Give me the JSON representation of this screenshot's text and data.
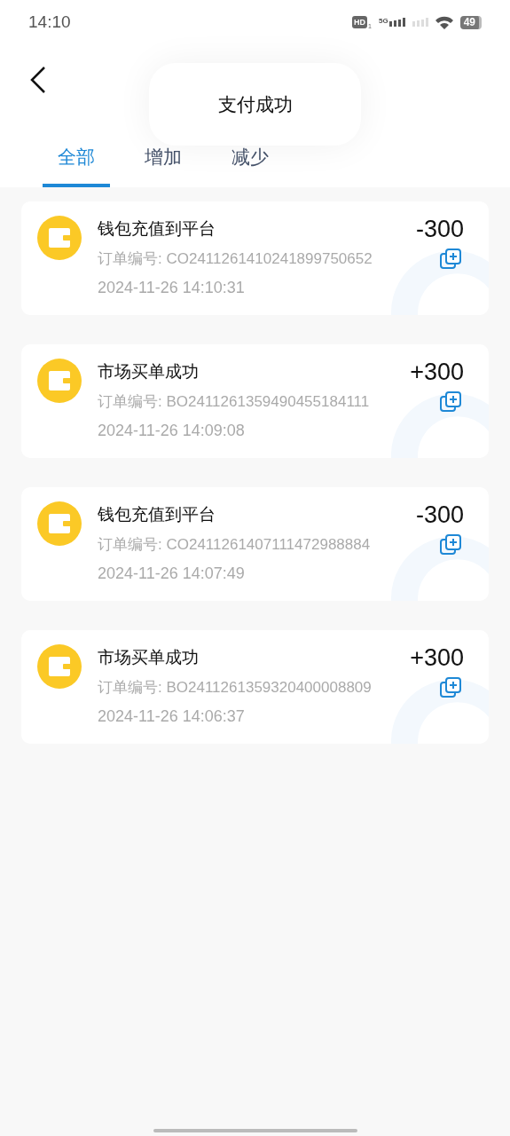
{
  "status_bar": {
    "time": "14:10",
    "hd_badge": "HD",
    "sim_index": "1",
    "network": "5G",
    "battery": "49"
  },
  "toast": {
    "message": "支付成功"
  },
  "tabs": [
    {
      "label": "全部",
      "selected": true
    },
    {
      "label": "增加",
      "selected": false
    },
    {
      "label": "减少",
      "selected": false
    }
  ],
  "transactions": [
    {
      "title": "钱包充值到平台",
      "amount": "-300",
      "order_no": "订单编号: CO2411261410241899750652",
      "time": "2024-11-26 14:10:31"
    },
    {
      "title": "市场买单成功",
      "amount": "+300",
      "order_no": "订单编号: BO2411261359490455184111",
      "time": "2024-11-26 14:09:08"
    },
    {
      "title": "钱包充值到平台",
      "amount": "-300",
      "order_no": "订单编号: CO2411261407111472988884",
      "time": "2024-11-26 14:07:49"
    },
    {
      "title": "市场买单成功",
      "amount": "+300",
      "order_no": "订单编号: BO2411261359320400008809",
      "time": "2024-11-26 14:06:37"
    }
  ]
}
